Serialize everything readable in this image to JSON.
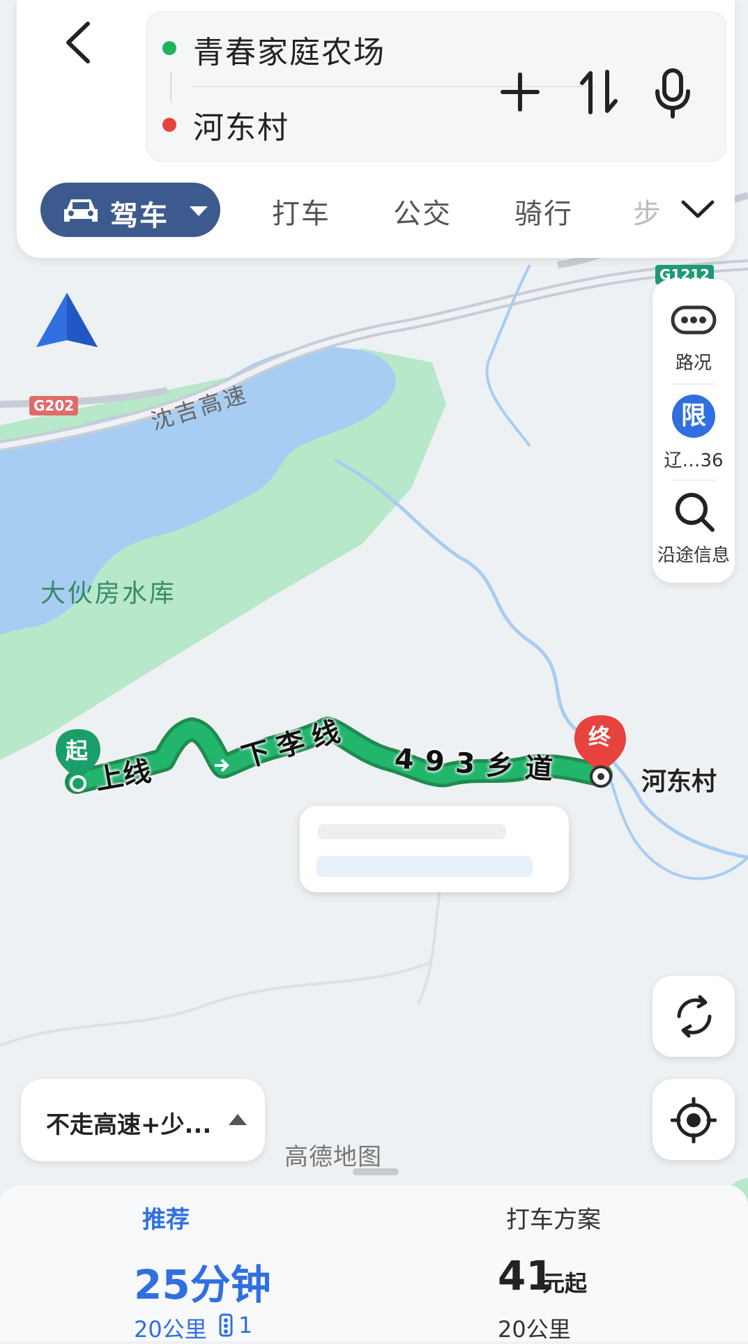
{
  "header": {
    "start_location": "青春家庭农场",
    "end_location": "河东村",
    "add_waypoint_icon": "plus-icon",
    "swap_icon": "swap-icon",
    "voice_icon": "microphone-icon"
  },
  "modes": {
    "active": "驾车",
    "tabs": [
      "打车",
      "公交",
      "骑行",
      "步"
    ]
  },
  "side_controls": {
    "traffic_label": "路况",
    "restriction_badge": "限",
    "restriction_label": "辽…36",
    "along_route_label": "沿途信息"
  },
  "map": {
    "highway_label": "沈吉高速",
    "reservoir_label": "大伙房水库",
    "shield_g202": "G202",
    "shield_g1212": "G1212",
    "road_segments": [
      "上线",
      "下李线",
      "493乡道"
    ],
    "start_marker": "起",
    "end_marker": "终",
    "destination_label": "河东村",
    "watermark": "高德地图"
  },
  "preferences": {
    "label": "不走高速+少..."
  },
  "plans": [
    {
      "title": "推荐",
      "time": "25分钟",
      "distance": "20公里",
      "lights": "1"
    },
    {
      "title": "打车方案",
      "price": "41",
      "price_unit": "元起",
      "distance": "20公里"
    }
  ],
  "colors": {
    "accent_blue": "#2f6fe0",
    "route_green": "#22b56c",
    "start_green": "#1a9e6a",
    "end_red": "#e8423f",
    "mode_active_bg": "#3c5a8e",
    "water": "#a8cdf2",
    "park": "#b7e8c9"
  }
}
